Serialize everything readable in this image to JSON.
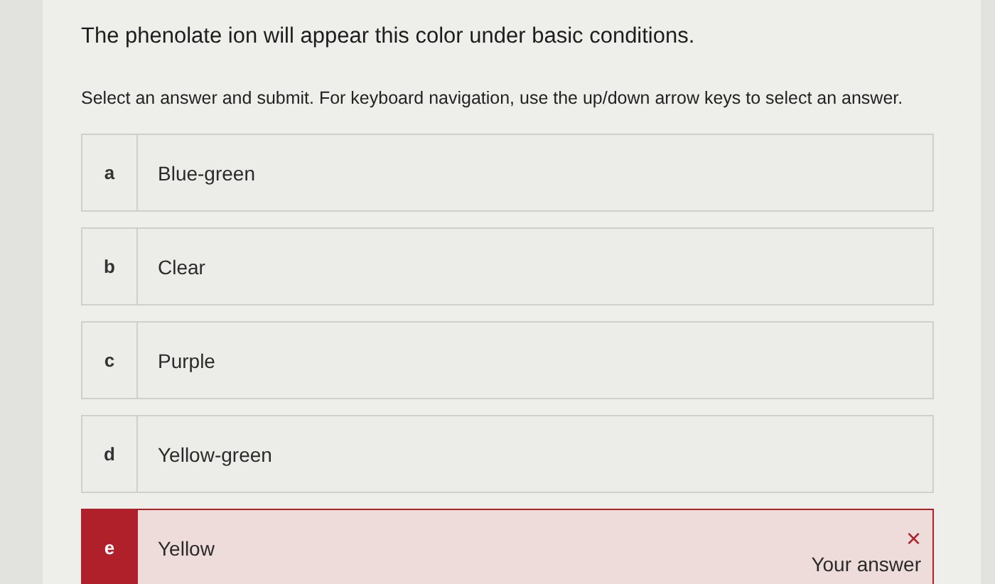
{
  "question": "The phenolate ion will appear this color under basic conditions.",
  "instructions": "Select an answer and submit. For keyboard navigation, use the up/down arrow keys to select an answer.",
  "options": [
    {
      "letter": "a",
      "text": "Blue-green",
      "selected": false
    },
    {
      "letter": "b",
      "text": "Clear",
      "selected": false
    },
    {
      "letter": "c",
      "text": "Purple",
      "selected": false
    },
    {
      "letter": "d",
      "text": "Yellow-green",
      "selected": false
    },
    {
      "letter": "e",
      "text": "Yellow",
      "selected": true,
      "mark": "×",
      "note": "Your answer"
    }
  ]
}
